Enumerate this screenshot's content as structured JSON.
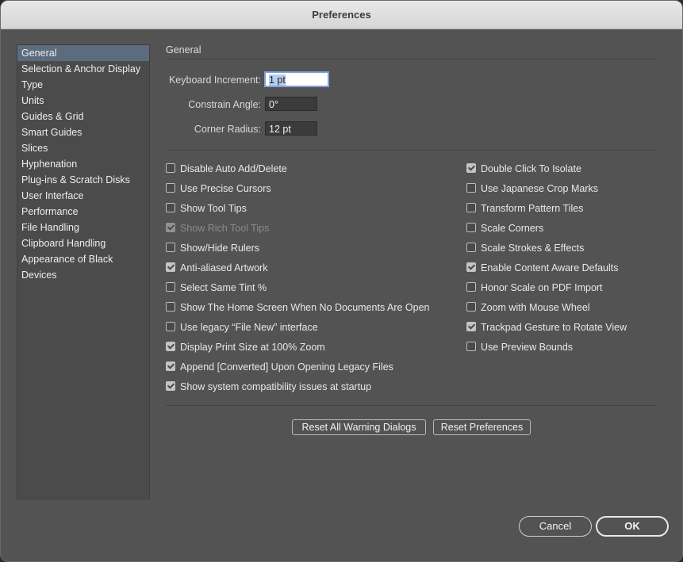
{
  "window": {
    "title": "Preferences"
  },
  "sidebar": {
    "items": [
      {
        "label": "General",
        "active": true
      },
      {
        "label": "Selection & Anchor Display"
      },
      {
        "label": "Type"
      },
      {
        "label": "Units"
      },
      {
        "label": "Guides & Grid"
      },
      {
        "label": "Smart Guides"
      },
      {
        "label": "Slices"
      },
      {
        "label": "Hyphenation"
      },
      {
        "label": "Plug-ins & Scratch Disks"
      },
      {
        "label": "User Interface"
      },
      {
        "label": "Performance"
      },
      {
        "label": "File Handling"
      },
      {
        "label": "Clipboard Handling"
      },
      {
        "label": "Appearance of Black"
      },
      {
        "label": "Devices"
      }
    ]
  },
  "general": {
    "section_title": "General",
    "keyboard_increment": {
      "label": "Keyboard Increment:",
      "value": "1 pt"
    },
    "constrain_angle": {
      "label": "Constrain Angle:",
      "value": "0°"
    },
    "corner_radius": {
      "label": "Corner Radius:",
      "value": "12 pt"
    },
    "left_options": [
      {
        "label": "Disable Auto Add/Delete",
        "checked": false
      },
      {
        "label": "Use Precise Cursors",
        "checked": false
      },
      {
        "label": "Show Tool Tips",
        "checked": false
      },
      {
        "label": "Show Rich Tool Tips",
        "checked": true,
        "disabled": true
      },
      {
        "label": "Show/Hide Rulers",
        "checked": false
      },
      {
        "label": "Anti-aliased Artwork",
        "checked": true
      },
      {
        "label": "Select Same Tint %",
        "checked": false
      },
      {
        "label": "Show The Home Screen When No Documents Are Open",
        "checked": false
      },
      {
        "label": "Use legacy “File New” interface",
        "checked": false
      },
      {
        "label": "Display Print Size at 100% Zoom",
        "checked": true
      },
      {
        "label": "Append [Converted] Upon Opening Legacy Files",
        "checked": true
      },
      {
        "label": "Show system compatibility issues at startup",
        "checked": true
      }
    ],
    "right_options": [
      {
        "label": "Double Click To Isolate",
        "checked": true
      },
      {
        "label": "Use Japanese Crop Marks",
        "checked": false
      },
      {
        "label": "Transform Pattern Tiles",
        "checked": false
      },
      {
        "label": "Scale Corners",
        "checked": false
      },
      {
        "label": "Scale Strokes & Effects",
        "checked": false
      },
      {
        "label": "Enable Content Aware Defaults",
        "checked": true
      },
      {
        "label": "Honor Scale on PDF Import",
        "checked": false
      },
      {
        "label": "Zoom with Mouse Wheel",
        "checked": false
      },
      {
        "label": "Trackpad Gesture to Rotate View",
        "checked": true
      },
      {
        "label": "Use Preview Bounds",
        "checked": false
      }
    ],
    "reset_warnings_label": "Reset All Warning Dialogs",
    "reset_preferences_label": "Reset Preferences"
  },
  "footer": {
    "cancel_label": "Cancel",
    "ok_label": "OK"
  }
}
